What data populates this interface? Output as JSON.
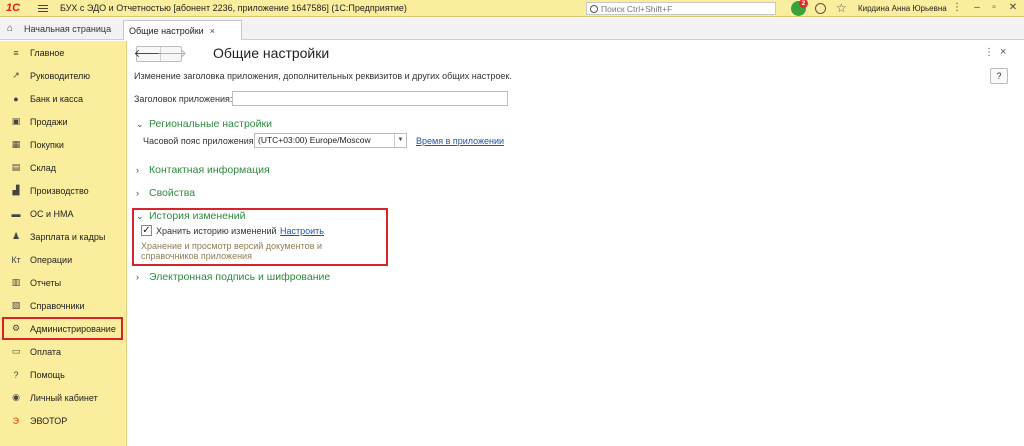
{
  "titlebar": {
    "logo": "1С",
    "title": "БУХ с ЭДО и Отчетностью [абонент 2236, приложение 1647586]  (1С:Предприятие)",
    "search_placeholder": "Поиск Ctrl+Shift+F",
    "notification_count": "2",
    "user": "Кирдина Анна Юрьевна",
    "menu_glyph": "⋮",
    "minimize_glyph": "–",
    "restore_glyph": "▫",
    "close_glyph": "✕"
  },
  "tabs": {
    "home": "Начальная страница",
    "active": "Общие настройки",
    "close_glyph": "×"
  },
  "sidebar": {
    "items": [
      {
        "label": "Главное",
        "icon": "≡"
      },
      {
        "label": "Руководителю",
        "icon": "↗"
      },
      {
        "label": "Банк и касса",
        "icon": "●"
      },
      {
        "label": "Продажи",
        "icon": "▣"
      },
      {
        "label": "Покупки",
        "icon": "▦"
      },
      {
        "label": "Склад",
        "icon": "▤"
      },
      {
        "label": "Производство",
        "icon": "▟"
      },
      {
        "label": "ОС и НМА",
        "icon": "▬"
      },
      {
        "label": "Зарплата и кадры",
        "icon": "♟"
      },
      {
        "label": "Операции",
        "icon": "Кт"
      },
      {
        "label": "Отчеты",
        "icon": "▥"
      },
      {
        "label": "Справочники",
        "icon": "▧"
      },
      {
        "label": "Администрирование",
        "icon": "⚙"
      },
      {
        "label": "Оплата",
        "icon": "▭"
      },
      {
        "label": "Помощь",
        "icon": "?"
      },
      {
        "label": "Личный кабинет",
        "icon": "◉"
      },
      {
        "label": "ЭВОТОР",
        "icon": "Э"
      }
    ]
  },
  "content": {
    "back_glyph": "🡐",
    "forward_glyph": "🡒",
    "title": "Общие настройки",
    "more_glyph": "⋮",
    "close_glyph": "×",
    "help": "?",
    "description": "Изменение заголовка приложения, дополнительных реквизитов и других общих настроек.",
    "app_title_label": "Заголовок приложения:",
    "app_title_value": "",
    "regional": {
      "title": "Региональные настройки",
      "timezone_label": "Часовой пояс приложения:",
      "timezone_value": "(UTC+03:00) Europe/Moscow",
      "time_link": "Время в приложении"
    },
    "contact": "Контактная информация",
    "properties": "Свойства",
    "history": {
      "title": "История изменений",
      "checkbox_label": "Хранить историю изменений",
      "checked": true,
      "configure_link": "Настроить",
      "hint": "Хранение и просмотр версий документов и справочников приложения"
    },
    "esign": "Электронная подпись и шифрование"
  },
  "colors": {
    "sidebar_bg": "#fbed9e",
    "section_green": "#2f8a43",
    "highlight_red": "#d8232a",
    "link_blue": "#2254a3"
  }
}
